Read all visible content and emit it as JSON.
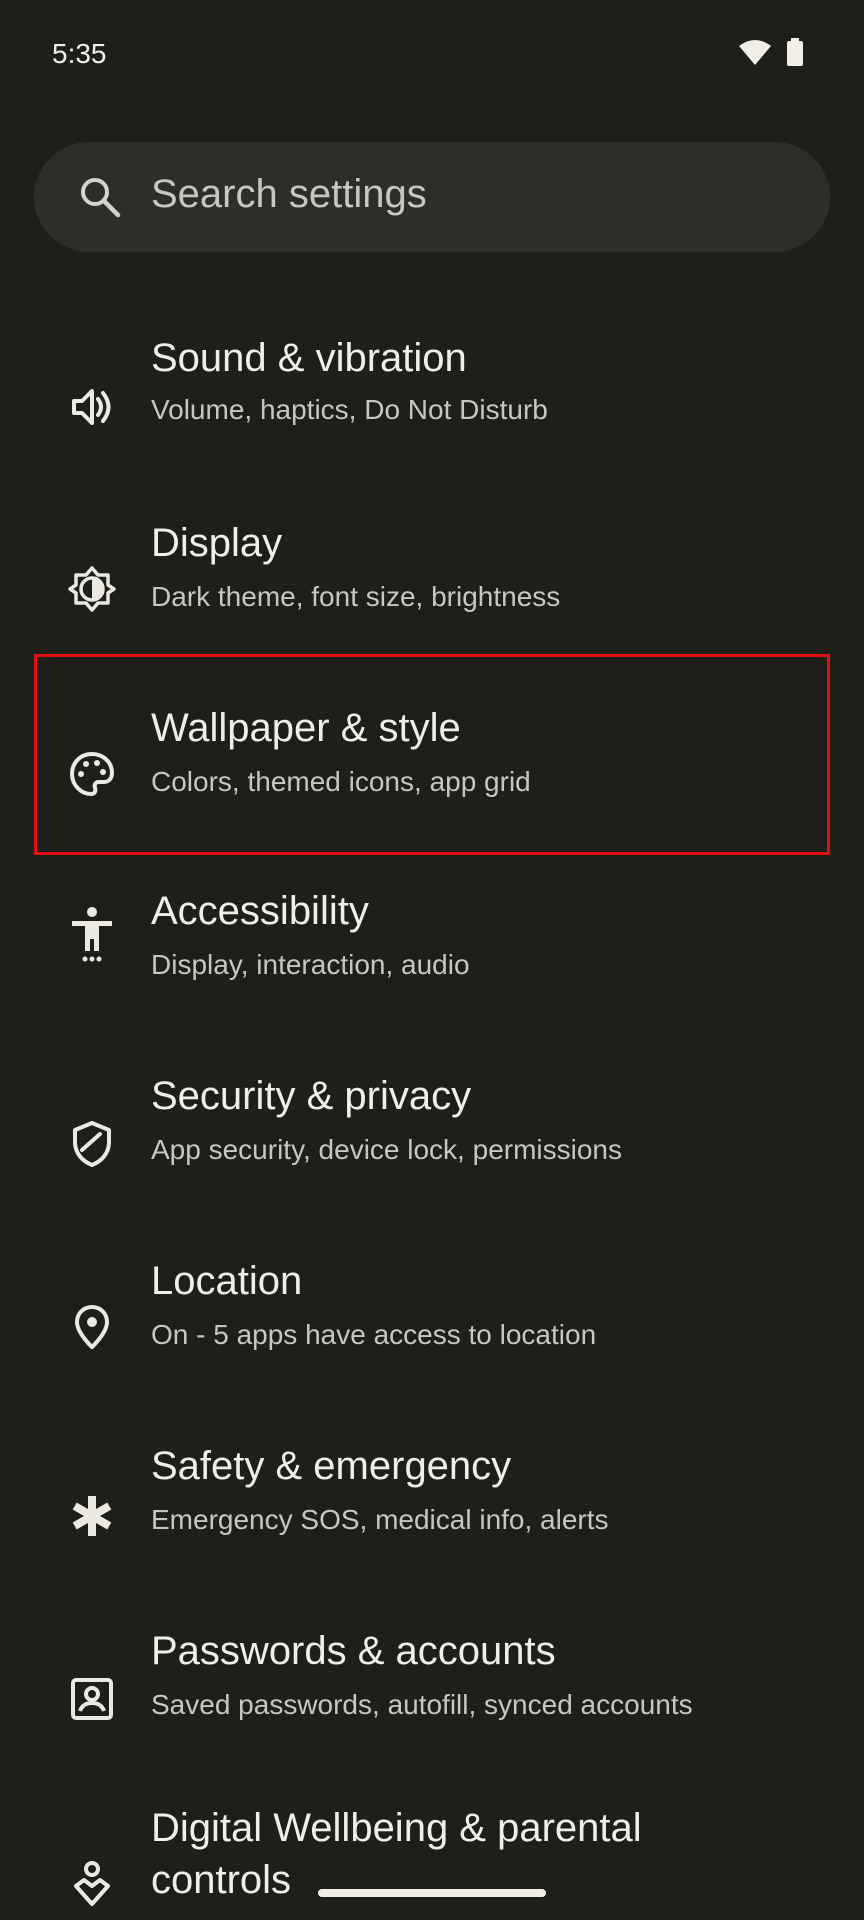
{
  "status_bar": {
    "time": "5:35"
  },
  "search": {
    "placeholder": "Search settings"
  },
  "settings": [
    {
      "icon": "volume-icon",
      "title": "Sound & vibration",
      "subtitle": "Volume, haptics, Do Not Disturb"
    },
    {
      "icon": "brightness-icon",
      "title": "Display",
      "subtitle": "Dark theme, font size, brightness"
    },
    {
      "icon": "palette-icon",
      "title": "Wallpaper & style",
      "subtitle": "Colors, themed icons, app grid"
    },
    {
      "icon": "accessibility-icon",
      "title": "Accessibility",
      "subtitle": "Display, interaction, audio"
    },
    {
      "icon": "shield-icon",
      "title": "Security & privacy",
      "subtitle": "App security, device lock, permissions"
    },
    {
      "icon": "location-pin-icon",
      "title": "Location",
      "subtitle": "On - 5 apps have access to location"
    },
    {
      "icon": "asterisk-icon",
      "title": "Safety & emergency",
      "subtitle": "Emergency SOS, medical info, alerts"
    },
    {
      "icon": "account-box-icon",
      "title": "Passwords & accounts",
      "subtitle": "Saved passwords, autofill, synced accounts"
    },
    {
      "icon": "wellbeing-icon",
      "title": "Digital Wellbeing & parental",
      "title_line2": "controls"
    }
  ],
  "colors": {
    "background": "#1e1e1b",
    "search_bg": "#2d2d29",
    "highlight": "#e01010"
  }
}
